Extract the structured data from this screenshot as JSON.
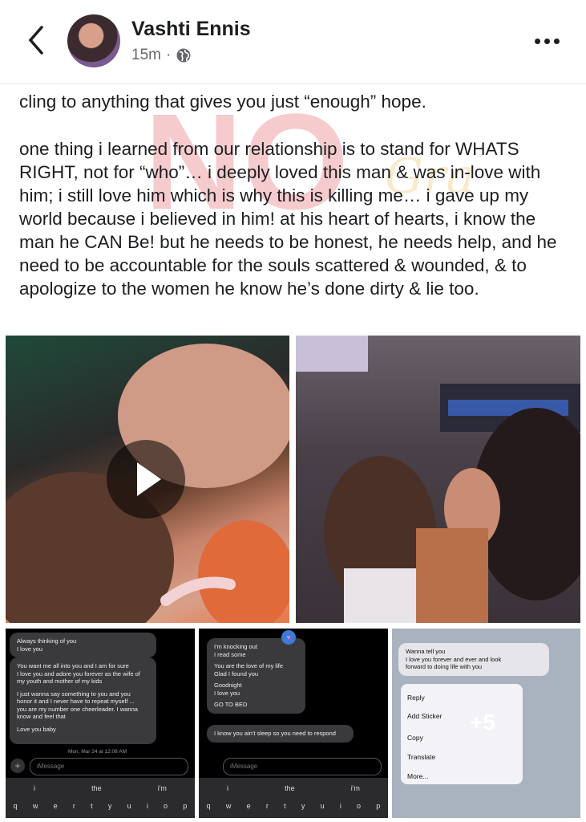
{
  "header": {
    "author": "Vashti Ennis",
    "time": "15m",
    "separator": "·"
  },
  "post": {
    "line_cut": "cling to anything that gives you just “enough” hope.",
    "paragraph2": "one thing i learned from our relationship is to stand for WHATS RIGHT, not for “who”… i deeply loved this man & was in-love with him; i still love him which is why this is killing me… i gave up my world because i believed in him! at his heart of hearts, i know the man he CAN Be! but he needs to be honest, he needs help, and he need to be accountable for the souls scattered & wounded, & to apologize to the women he know he’s done dirty & lie too.",
    "watermark": "NO"
  },
  "screenshot1": {
    "b1": [
      "Always thinking of you",
      "I love you"
    ],
    "b2": [
      "You want me all into you and I am for sure",
      "I love you and adore you forever as the wife of",
      "my youth and mother of my kids",
      "",
      "I just wanna say something to you and you",
      "honor it and I never have to repeat myself ...",
      "you are my number one cheerleader. I wanna",
      "know and feel that",
      "",
      "Love you baby"
    ],
    "timestamp": "Mon, Mar 24 at 12:08 AM",
    "placeholder": "iMessage",
    "suggest": [
      "i",
      "the",
      "i'm"
    ],
    "keys": [
      "q",
      "w",
      "e",
      "r",
      "t",
      "y",
      "u",
      "i",
      "o",
      "p"
    ]
  },
  "screenshot2": {
    "b1": [
      "I'm knocking out",
      "I read some",
      "",
      "You are the love of my life",
      "Glad I found you",
      "",
      "Goodnight",
      "I love you",
      "",
      "GO TO BED"
    ],
    "b2": [
      "I know you ain't sleep so you need to respond"
    ],
    "placeholder": "iMessage",
    "suggest": [
      "i",
      "the",
      "i'm"
    ],
    "keys": [
      "q",
      "w",
      "e",
      "r",
      "t",
      "y",
      "u",
      "i",
      "o",
      "p"
    ]
  },
  "screenshot3": {
    "bubble": [
      "Wanna tell you",
      "I love you forever and ever and look",
      "forward to doing life with you"
    ],
    "menu": [
      "Reply",
      "Add Sticker",
      "Copy",
      "Translate",
      "More..."
    ],
    "more_count": "+5"
  },
  "colors": {
    "accent": "#1877f2",
    "watermark": "#e0484f"
  }
}
